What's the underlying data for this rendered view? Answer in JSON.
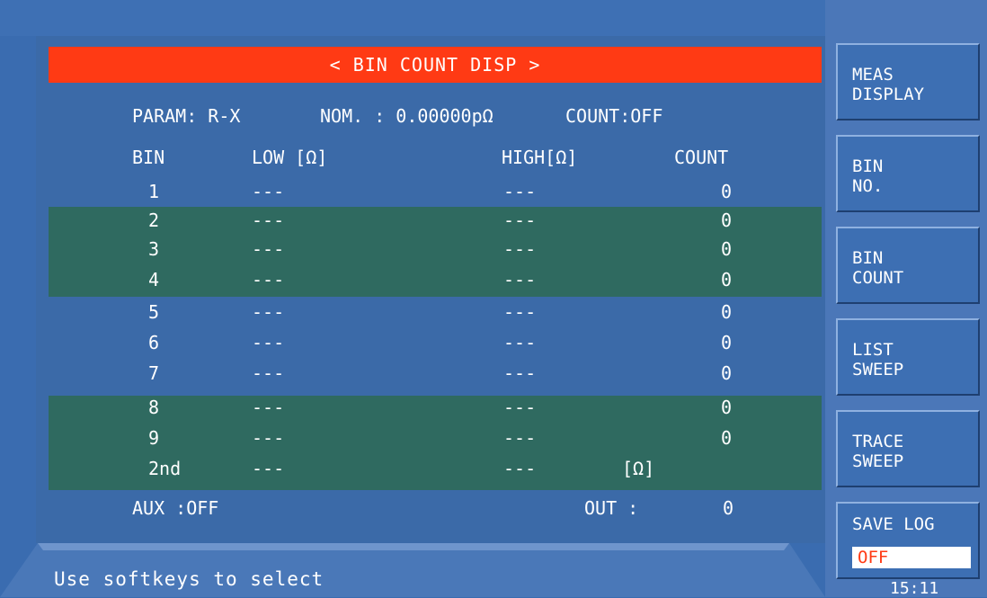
{
  "title": "< BIN COUNT DISP >",
  "params": {
    "param": "PARAM: R-X",
    "nom": "NOM. : 0.00000pΩ",
    "count": "COUNT:OFF"
  },
  "table": {
    "headers": {
      "bin": "BIN",
      "low": "LOW [Ω]",
      "high": "HIGH[Ω]",
      "count": "COUNT"
    },
    "rows": [
      {
        "bin": "1",
        "low": "---",
        "high": "---",
        "count": "0"
      },
      {
        "bin": "2",
        "low": "---",
        "high": "---",
        "count": "0"
      },
      {
        "bin": "3",
        "low": "---",
        "high": "---",
        "count": "0"
      },
      {
        "bin": "4",
        "low": "---",
        "high": "---",
        "count": "0"
      },
      {
        "bin": "5",
        "low": "---",
        "high": "---",
        "count": "0"
      },
      {
        "bin": "6",
        "low": "---",
        "high": "---",
        "count": "0"
      },
      {
        "bin": "7",
        "low": "---",
        "high": "---",
        "count": "0"
      },
      {
        "bin": "8",
        "low": "---",
        "high": "---",
        "count": "0"
      },
      {
        "bin": "9",
        "low": "---",
        "high": "---",
        "count": "0"
      },
      {
        "bin": "2nd",
        "low": "---",
        "high": "---",
        "count": "[Ω]"
      }
    ]
  },
  "aux": "AUX :OFF",
  "out_label": "OUT :",
  "out_value": "0",
  "status": "Use softkeys to select",
  "softkeys": [
    {
      "label": "MEAS\nDISPLAY"
    },
    {
      "label": "BIN\nNO."
    },
    {
      "label": "BIN\nCOUNT"
    },
    {
      "label": "LIST\nSWEEP"
    },
    {
      "label": "TRACE\nSWEEP"
    },
    {
      "label": "SAVE LOG",
      "value": "OFF"
    }
  ],
  "clock": "15:11",
  "colors": {
    "background": "#3a6cb0",
    "title_bar": "#ff3a14",
    "stripe": "#2f6a60",
    "text": "#ffffff"
  }
}
